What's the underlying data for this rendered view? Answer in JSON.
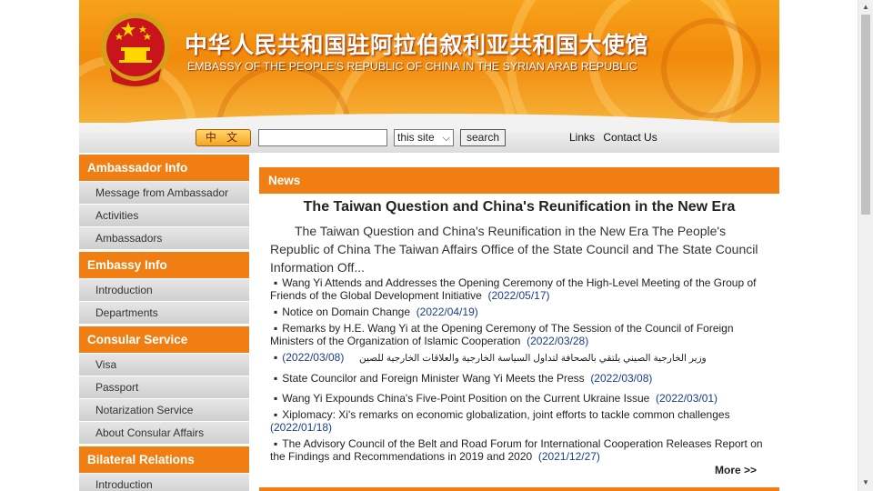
{
  "header": {
    "title_cn": "中华人民共和国驻阿拉伯叙利亚共和国大使馆",
    "title_en": "EMBASSY OF THE PEOPLE'S REPUBLIC OF CHINA IN THE SYRIAN ARAB REPUBLIC"
  },
  "toolbar": {
    "lang_label": "中 文",
    "search_placeholder": "",
    "scope_value": "this site",
    "search_label": "search",
    "links": [
      "Links",
      "Contact Us"
    ]
  },
  "sidebar": {
    "sections": [
      {
        "title": "Ambassador Info",
        "items": [
          "Message from Ambassador",
          "Activities",
          "Ambassadors"
        ]
      },
      {
        "title": "Embassy Info",
        "items": [
          "Introduction",
          "Departments"
        ]
      },
      {
        "title": "Consular Service",
        "items": [
          "Visa",
          "Passport",
          "Notarization Service",
          "About Consular Affairs"
        ]
      },
      {
        "title": "Bilateral Relations",
        "items": [
          "Introduction"
        ]
      }
    ]
  },
  "main": {
    "section_title": "News",
    "feature_title": "The Taiwan Question and China's Reunification in the New Era",
    "feature_summary": "The Taiwan Question and China's Reunification in the New Era        The People's Republic of China        The Taiwan Affairs Office of the State Council and The State Council Information Off...",
    "news": [
      {
        "text": "Wang Yi Attends and Addresses the Opening Ceremony of the High-Level Meeting of the Group of Friends of the Global Development Initiative",
        "date": "(2022/05/17)"
      },
      {
        "text": "Notice on Domain Change",
        "date": "(2022/04/19)"
      },
      {
        "text": "Remarks by H.E. Wang Yi at the Opening Ceremony of The Session of the Council of Foreign Ministers of the Organization of Islamic Cooperation",
        "date": "(2022/03/28)"
      },
      {
        "text": "وزير الخارجية الصيني يلتقي بالصحافة لتداول السياسة الخارجية والعلاقات الخارجية للصين",
        "date": "(2022/03/08)"
      },
      {
        "text": "State Councilor and Foreign Minister Wang Yi Meets the Press",
        "date": "(2022/03/08)"
      },
      {
        "text": "Wang Yi Expounds China's Five-Point Position on the Current Ukraine Issue",
        "date": "(2022/03/01)"
      },
      {
        "text": "Xiplomacy: Xi's remarks on economic globalization, joint efforts to tackle common challenges",
        "date": "(2022/01/18)"
      },
      {
        "text": "The Advisory Council of the Belt and Road Forum for International Cooperation Releases Report on the Findings  and Recommendations in 2019  and 2020",
        "date": "(2021/12/27)"
      }
    ],
    "more_label": "More >>"
  },
  "colors": {
    "accent": "#f07e12",
    "banner": "#f28a0c",
    "date_text": "#1a3d8f"
  }
}
